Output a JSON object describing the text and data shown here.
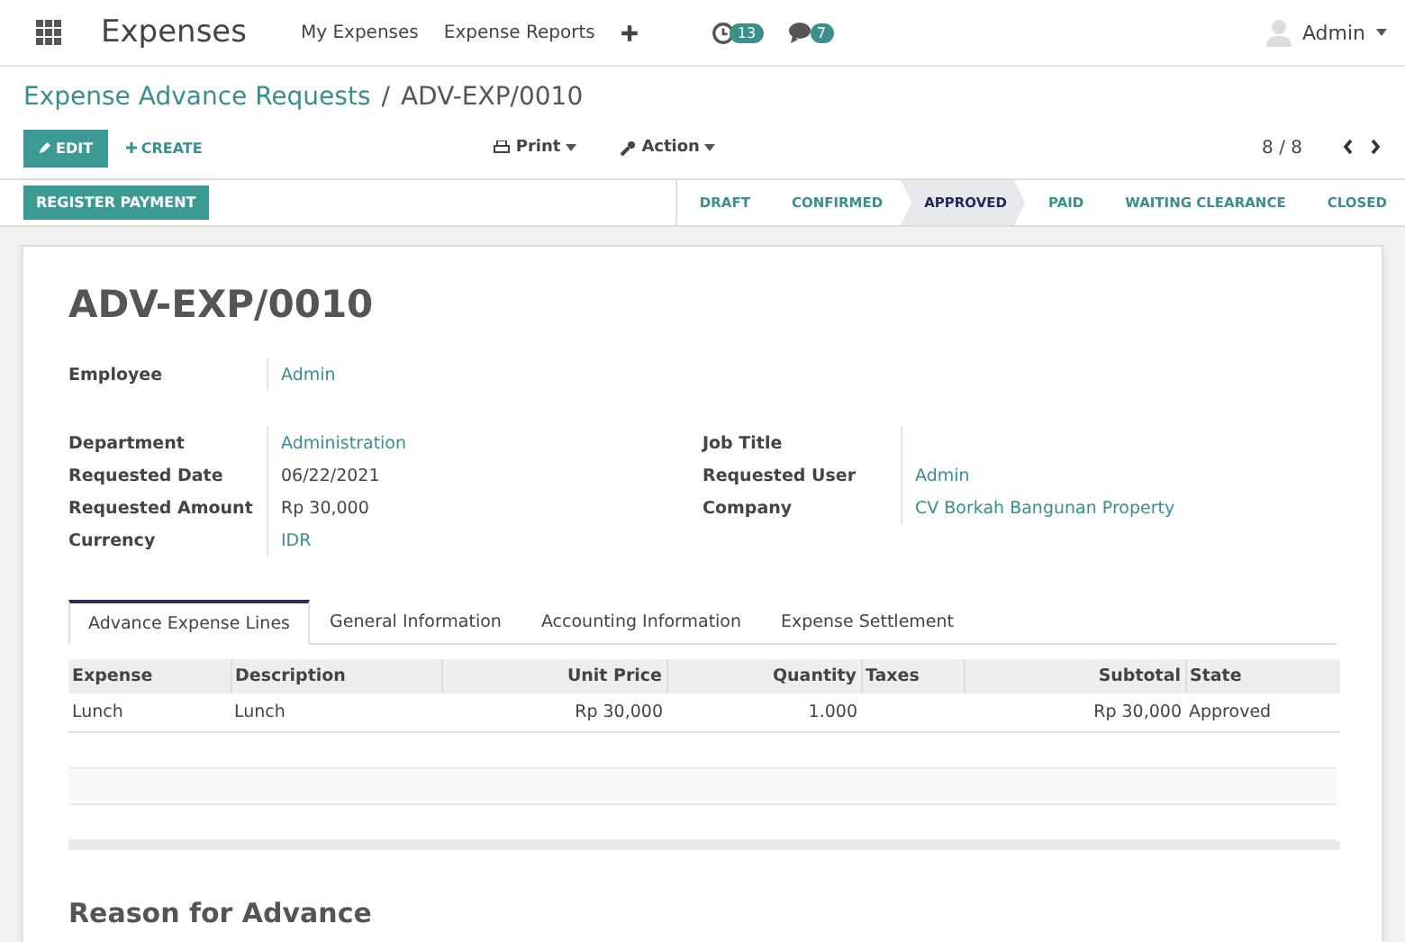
{
  "navbar": {
    "app_name": "Expenses",
    "menus": [
      "My Expenses",
      "Expense Reports"
    ],
    "activity_count": "13",
    "message_count": "7",
    "user": "Admin"
  },
  "breadcrumb": {
    "parent": "Expense Advance Requests",
    "separator": "/",
    "current": "ADV-EXP/0010"
  },
  "control_panel": {
    "edit": "EDIT",
    "create": "CREATE",
    "print": "Print",
    "action": "Action",
    "pager": "8 / 8"
  },
  "statusbar": {
    "button": "REGISTER PAYMENT",
    "stages": [
      {
        "label": "DRAFT",
        "selected": false
      },
      {
        "label": "CONFIRMED",
        "selected": false
      },
      {
        "label": "APPROVED",
        "selected": true
      },
      {
        "label": "PAID",
        "selected": false
      },
      {
        "label": "WAITING CLEARANCE",
        "selected": false
      },
      {
        "label": "CLOSED",
        "selected": false
      }
    ]
  },
  "sheet": {
    "title": "ADV-EXP/0010",
    "employee": {
      "label": "Employee",
      "value": "Admin",
      "link": true
    },
    "left_fields": [
      {
        "label": "Department",
        "value": "Administration",
        "link": true
      },
      {
        "label": "Requested Date",
        "value": "06/22/2021",
        "link": false
      },
      {
        "label": "Requested Amount",
        "value": "Rp 30,000",
        "link": false
      },
      {
        "label": "Currency",
        "value": "IDR",
        "link": true
      }
    ],
    "right_fields": [
      {
        "label": "Job Title"
      },
      {
        "label": "Requested User",
        "value": "Admin",
        "link": true
      },
      {
        "label": "Company",
        "value": "CV Borkah Bangunan Property",
        "link": true
      }
    ],
    "tabs": [
      {
        "label": "Advance Expense Lines",
        "selected": true
      },
      {
        "label": "General Information",
        "selected": false
      },
      {
        "label": "Accounting Information",
        "selected": false
      },
      {
        "label": "Expense Settlement",
        "selected": false
      }
    ],
    "table": {
      "columns": [
        {
          "label": "Expense"
        },
        {
          "label": "Description"
        },
        {
          "label": "Unit Price"
        },
        {
          "label": "Quantity"
        },
        {
          "label": "Taxes"
        },
        {
          "label": "Subtotal"
        },
        {
          "label": "State"
        }
      ],
      "rows": [
        [
          "Lunch",
          "Lunch",
          "Rp 30,000",
          "1.000",
          "",
          "Rp 30,000",
          "Approved"
        ]
      ]
    },
    "section_title": "Reason for Advance"
  }
}
